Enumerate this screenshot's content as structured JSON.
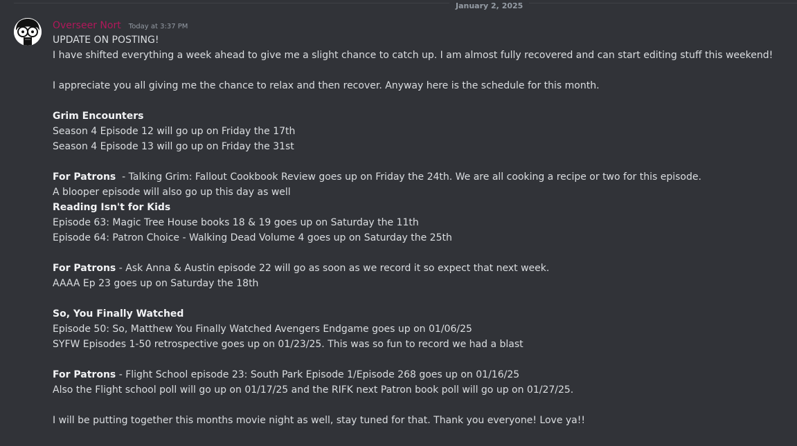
{
  "divider": {
    "date": "January 2, 2025"
  },
  "message": {
    "author": "Overseer Nort",
    "timestamp": "Today at 3:37 PM",
    "author_color": "#b0185a",
    "blocks": [
      {
        "text": "UPDATE ON POSTING!"
      },
      {
        "text": "I have shifted everything a week ahead to give me a slight chance to catch up. I am almost fully recovered and can start editing stuff this weekend!"
      },
      {
        "gap": true
      },
      {
        "text": "I appreciate you all giving me the chance to relax and then recover. Anyway here is the schedule for this month."
      },
      {
        "gap": true
      },
      {
        "bold": "Grim Encounters"
      },
      {
        "text": "Season 4 Episode 12 will go up on Friday the 17th"
      },
      {
        "text": "Season 4 Episode 13 will go up on Friday the 31st"
      },
      {
        "gap": true
      },
      {
        "bold": "For Patrons",
        "text": "  - Talking Grim: Fallout Cookbook Review goes up on Friday the 24th. We are all cooking a recipe or two for this episode."
      },
      {
        "text": "A blooper episode will also go up this day as well"
      },
      {
        "bold": "Reading Isn't for Kids"
      },
      {
        "text": "Episode 63: Magic Tree House books 18 & 19 goes up on Saturday the 11th"
      },
      {
        "text": "Episode 64: Patron Choice - Walking Dead Volume 4 goes up on Saturday the 25th"
      },
      {
        "gap": true
      },
      {
        "bold": "For Patrons",
        "text": " - Ask Anna & Austin episode 22 will go as soon as we record it so expect that next week."
      },
      {
        "text": "AAAA Ep 23 goes up on Saturday the 18th"
      },
      {
        "gap": true
      },
      {
        "bold": "So, You Finally Watched"
      },
      {
        "text": "Episode 50: So, Matthew You Finally Watched Avengers Endgame goes up on 01/06/25"
      },
      {
        "text": "SYFW Episodes 1-50 retrospective goes up on 01/23/25. This was so fun to record we had a blast"
      },
      {
        "gap": true
      },
      {
        "bold": "For Patrons",
        "text": " - Flight School episode 23: South Park Episode 1/Episode 268 goes up on 01/16/25"
      },
      {
        "text": "Also the Flight school poll will go up on 01/17/25 and the RIFK next Patron book poll will go up on 01/27/25."
      },
      {
        "gap": true
      },
      {
        "text": "I will be putting together this months movie night as well, stay tuned for that. Thank you everyone! Love ya!!"
      }
    ]
  }
}
